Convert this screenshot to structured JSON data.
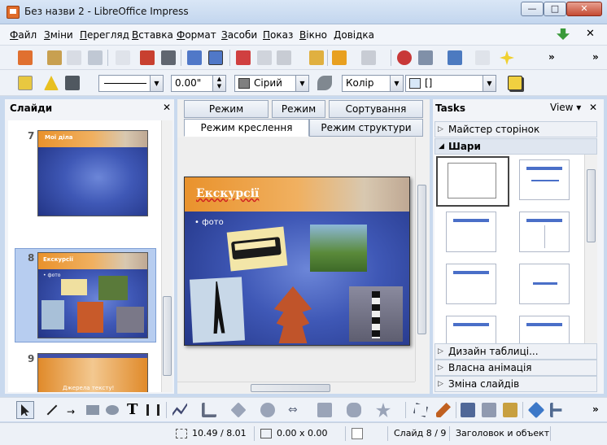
{
  "window": {
    "title": "Без назви 2 - LibreOffice Impress",
    "min_glyph": "—",
    "max_glyph": "□",
    "close_glyph": "✕"
  },
  "menubar": {
    "items": [
      {
        "key": "Ф",
        "rest": "айл"
      },
      {
        "key": "З",
        "rest": "міни"
      },
      {
        "key": "П",
        "rest": "ерегляд"
      },
      {
        "key": "В",
        "rest": "ставка"
      },
      {
        "key": "Ф",
        "rest": "ормат"
      },
      {
        "key": "З",
        "rest": "асоби"
      },
      {
        "key": "П",
        "rest": "оказ"
      },
      {
        "key": "В",
        "rest": "ікно"
      },
      {
        "key": "Д",
        "rest": "овідка"
      }
    ],
    "doc_close_glyph": "✕"
  },
  "toolbar2": {
    "line_width": "0.00\"",
    "area_color": "Сірий",
    "area_style": "Колір",
    "area_fill": "[]"
  },
  "slides_pane": {
    "title": "Слайди",
    "close_glyph": "✕",
    "slides": [
      {
        "number": "7",
        "title": "Мої діла"
      },
      {
        "number": "8",
        "title": "Екскурсії",
        "bullet": "• фото"
      },
      {
        "number": "9",
        "title": "Джерела тексту!"
      }
    ]
  },
  "view_tabs": {
    "row1": [
      "Режим приміток",
      "Режим тез",
      "Сортування слайду"
    ],
    "row2": [
      "Режим креслення",
      "Режим структури"
    ]
  },
  "main_slide": {
    "title": "Екскурсії",
    "bullet": "• фото"
  },
  "tasks": {
    "title": "Tasks",
    "view_label": "View",
    "close_glyph": "✕",
    "sections": [
      "Майстер сторінок",
      "Шари",
      "Дизайн таблиці...",
      "Власна анімація",
      "Зміна слайдів"
    ]
  },
  "statusbar": {
    "position": "10.49 / 8.01",
    "size": "0.00 x 0.00",
    "slide": "Слайд 8 / 9",
    "layout": "Заголовок и объект"
  },
  "colors": {
    "accent_orange": "#e9922c",
    "slide_blue": "#3f58b6",
    "selection": "#b7cdf0"
  }
}
